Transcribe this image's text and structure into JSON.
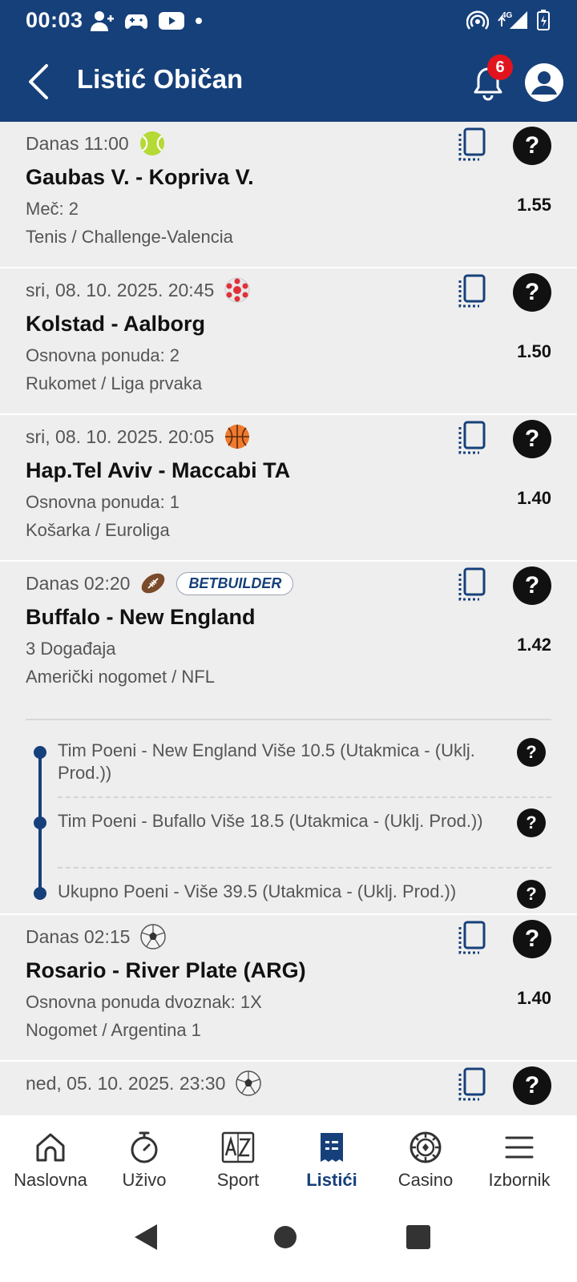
{
  "status": {
    "time": "00:03"
  },
  "appbar": {
    "title": "Listić Običan",
    "notification_count": "6"
  },
  "tickets": [
    {
      "datetime": "Danas 11:00",
      "sport_icon": "tennis-ball-icon",
      "match": "Gaubas V. - Kopriva V.",
      "pick": "Meč: 2",
      "league": "Tenis / Challenge-Valencia",
      "odd": "1.55"
    },
    {
      "datetime": "sri, 08. 10. 2025. 20:45",
      "sport_icon": "handball-icon",
      "match": "Kolstad - Aalborg",
      "pick": "Osnovna ponuda: 2",
      "league": "Rukomet / Liga prvaka",
      "odd": "1.50"
    },
    {
      "datetime": "sri, 08. 10. 2025. 20:05",
      "sport_icon": "basketball-icon",
      "match": "Hap.Tel Aviv - Maccabi TA",
      "pick": "Osnovna ponuda: 1",
      "league": "Košarka / Euroliga",
      "odd": "1.40"
    },
    {
      "datetime": "Danas 02:20",
      "sport_icon": "american-football-icon",
      "badge": "BETBUILDER",
      "match": "Buffalo - New England",
      "pick": "3 Događaja",
      "league": "Američki nogomet / NFL",
      "odd": "1.42",
      "legs": [
        "Tim Poeni - New England Više 10.5 (Utakmica - (Uklj. Prod.))",
        "Tim Poeni - Bufallo Više 18.5 (Utakmica - (Uklj. Prod.))",
        "Ukupno Poeni - Više 39.5 (Utakmica - (Uklj. Prod.))"
      ]
    },
    {
      "datetime": "Danas 02:15",
      "sport_icon": "soccer-ball-icon",
      "match": "Rosario - River Plate (ARG)",
      "pick": "Osnovna ponuda dvoznak: 1X",
      "league": "Nogomet / Argentina 1",
      "odd": "1.40"
    },
    {
      "datetime": "ned, 05. 10. 2025. 23:30",
      "sport_icon": "soccer-ball-icon"
    }
  ],
  "nav": [
    {
      "label": "Naslovna",
      "icon": "home-icon"
    },
    {
      "label": "Uživo",
      "icon": "stopwatch-icon"
    },
    {
      "label": "Sport",
      "icon": "az-icon"
    },
    {
      "label": "Listići",
      "icon": "ticket-icon",
      "active": true
    },
    {
      "label": "Casino",
      "icon": "casino-chip-icon"
    },
    {
      "label": "Izbornik",
      "icon": "menu-icon"
    }
  ],
  "colors": {
    "primary": "#16407a",
    "badge_red": "#e1141e",
    "card_bg": "#eeeeee"
  }
}
